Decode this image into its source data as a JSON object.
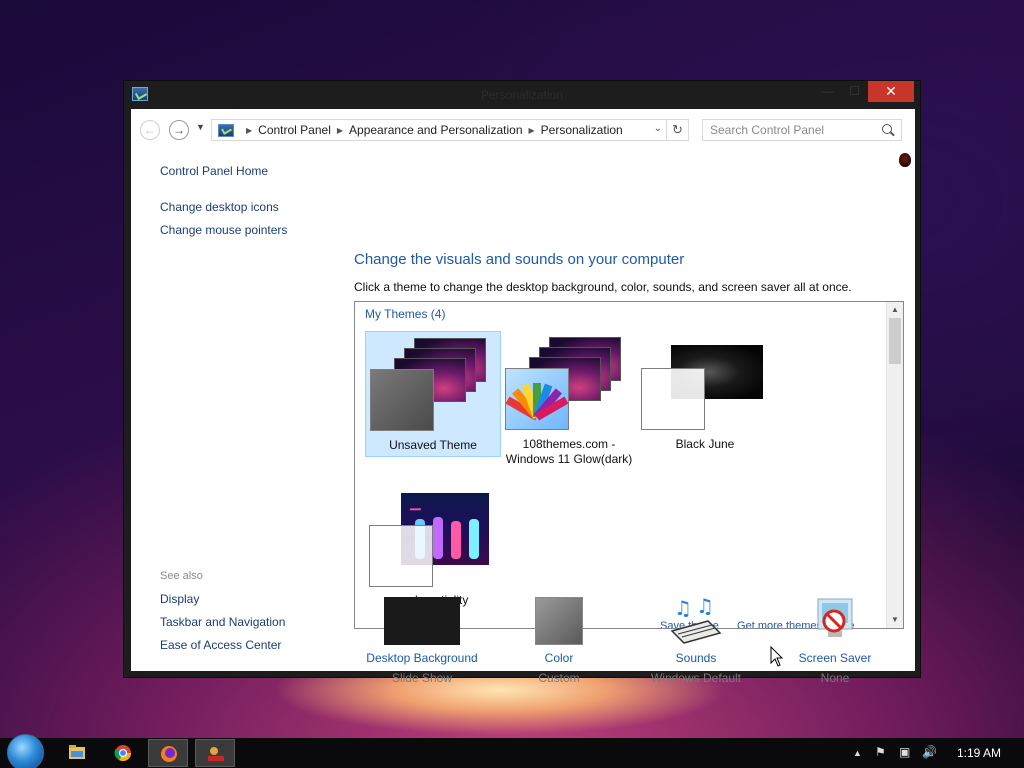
{
  "window": {
    "title": "Personalization",
    "minimize_glyph": "—",
    "maximize_glyph": "☐",
    "close_glyph": "✕"
  },
  "nav": {
    "breadcrumbs": [
      "Control Panel",
      "Appearance and Personalization",
      "Personalization"
    ],
    "search_placeholder": "Search Control Panel"
  },
  "left_pane": {
    "home": "Control Panel Home",
    "links": [
      "Change desktop icons",
      "Change mouse pointers"
    ],
    "see_also_label": "See also",
    "see_also": [
      "Display",
      "Taskbar and Navigation",
      "Ease of Access Center"
    ]
  },
  "main": {
    "heading": "Change the visuals and sounds on your computer",
    "subtext": "Click a theme to change the desktop background, color, sounds, and screen saver all at once.",
    "group_label": "My Themes (4)",
    "themes": [
      {
        "name": "Unsaved Theme",
        "selected": true
      },
      {
        "name": "108themes.com - Windows 11 Glow(dark)",
        "selected": false
      },
      {
        "name": "Black June",
        "selected": false
      },
      {
        "name": "mr beastiality",
        "selected": false
      }
    ],
    "cut_links": [
      "Save theme",
      "Get more themes online"
    ]
  },
  "options": [
    {
      "label": "Desktop Background",
      "sub": "Slide Show"
    },
    {
      "label": "Color",
      "sub": "Custom"
    },
    {
      "label": "Sounds",
      "sub": "Windows Default"
    },
    {
      "label": "Screen Saver",
      "sub": "None"
    }
  ],
  "taskbar": {
    "clock": "1:19 AM"
  },
  "colors": {
    "link": "#1e5aa8",
    "selection_bg": "#cde8ff",
    "close_button": "#c7352b"
  }
}
